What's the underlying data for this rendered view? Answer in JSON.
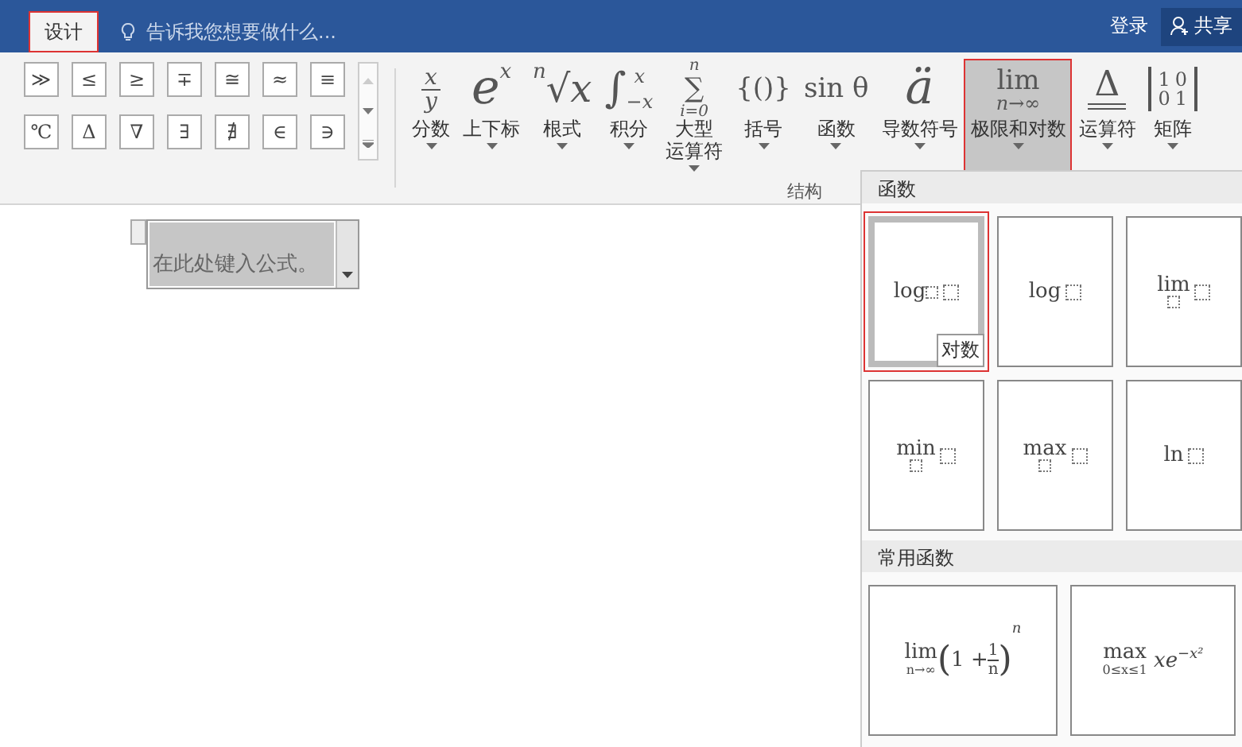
{
  "title_bar": {
    "tabs": [
      {
        "label": "设计",
        "selected": true
      }
    ],
    "tell_me": {
      "placeholder": "告诉我您想要做什么..."
    },
    "sign_in": "登录",
    "share": "共享"
  },
  "symbol_gallery": {
    "rows": [
      [
        "≫",
        "≤",
        "≥",
        "∓",
        "≅",
        "≈",
        "≡"
      ],
      [
        "℃",
        "Δ",
        "∇",
        "∃",
        "∄",
        "∈",
        "∋"
      ]
    ]
  },
  "structures": {
    "group_label": "结构",
    "buttons": [
      {
        "label": "分数",
        "kind": "fraction",
        "glyph": [
          "x",
          "y"
        ],
        "selected": false
      },
      {
        "label": "上下标",
        "kind": "script",
        "glyph": [
          "e",
          "x"
        ],
        "selected": false
      },
      {
        "label": "根式",
        "kind": "radical",
        "glyph": [
          "n",
          "√",
          "x"
        ],
        "selected": false
      },
      {
        "label": "积分",
        "kind": "integral",
        "glyph": [
          "∫",
          "x",
          "−x"
        ],
        "selected": false
      },
      {
        "label": [
          "大型",
          "运算符"
        ],
        "kind": "stack",
        "glyph": [
          "n",
          "∑",
          "i=0"
        ],
        "selected": false
      },
      {
        "label": "括号",
        "kind": "plain",
        "glyph": [
          "{()}"
        ],
        "selected": false
      },
      {
        "label": "函数",
        "kind": "plain",
        "glyph": [
          "sin θ"
        ],
        "selected": false
      },
      {
        "label": "导数符号",
        "kind": "accent",
        "glyph": [
          "ä"
        ],
        "selected": false
      },
      {
        "label": "极限和对数",
        "kind": "stack",
        "glyph": [
          "lim",
          "n→∞"
        ],
        "selected": true
      },
      {
        "label": "运算符",
        "kind": "operator",
        "glyph": [
          "Δ"
        ],
        "selected": false
      },
      {
        "label": "矩阵",
        "kind": "matrix",
        "glyph": [
          "1",
          "0",
          "0",
          "1"
        ],
        "selected": false
      }
    ]
  },
  "equation": {
    "text": "在此处键入公式。"
  },
  "gallery": {
    "sections": [
      {
        "title": "函数",
        "items": [
          {
            "kind": "base",
            "name": "log",
            "selected": true,
            "tooltip": "对数"
          },
          {
            "kind": "plain",
            "name": "log",
            "selected": false
          },
          {
            "kind": "under",
            "name": "lim",
            "selected": false
          },
          {
            "kind": "under",
            "name": "min",
            "selected": false
          },
          {
            "kind": "under",
            "name": "max",
            "selected": false
          },
          {
            "kind": "plain",
            "name": "ln",
            "selected": false
          }
        ]
      },
      {
        "title": "常用函数",
        "items": [
          {
            "kind": "limit-frac",
            "name": "lim",
            "under": "n→∞",
            "open": "(",
            "pre": "1 +",
            "close": ")",
            "num": "1",
            "den": "n",
            "sup": "n",
            "selected": false
          },
          {
            "kind": "expr",
            "name": "max",
            "under": "0≤x≤1",
            "expr": "xe",
            "sup": "−x²",
            "selected": false
          }
        ]
      }
    ]
  }
}
